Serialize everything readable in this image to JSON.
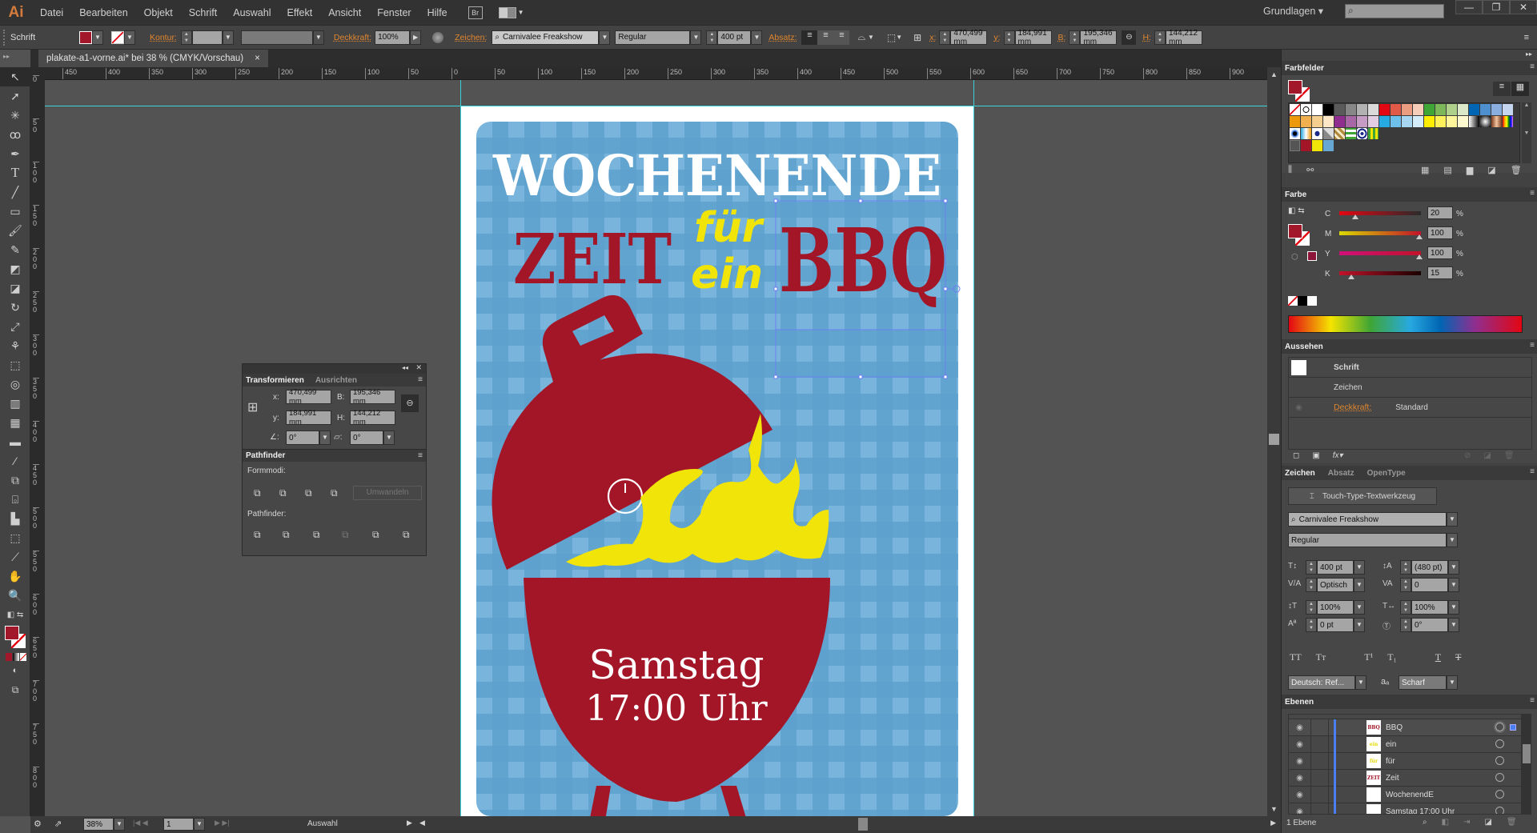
{
  "app": {
    "logo": "Ai",
    "menu": [
      "Datei",
      "Bearbeiten",
      "Objekt",
      "Schrift",
      "Auswahl",
      "Effekt",
      "Ansicht",
      "Fenster",
      "Hilfe"
    ],
    "bridge": "Br",
    "workspace": "Grundlagen ▾",
    "window_controls": [
      "—",
      "❐",
      "✕"
    ]
  },
  "control": {
    "label": "Schrift",
    "kontur": "Kontur:",
    "deckkraft": "Deckkraft:",
    "opacity": "100%",
    "zeichen": "Zeichen:",
    "font": "Carnivalee Freakshow",
    "style": "Regular",
    "size": "400 pt",
    "absatz": "Absatz:",
    "x_label": "x:",
    "x": "470,499 mm",
    "y_label": "y:",
    "y": "184,991 mm",
    "b_label": "B:",
    "b": "195,346 mm",
    "h_label": "H:",
    "h": "144,212 mm"
  },
  "document": {
    "tab": "plakate-a1-vorne.ai* bei 38 % (CMYK/Vorschau)",
    "close": "×"
  },
  "rulers": {
    "h": [
      "450",
      "400",
      "350",
      "300",
      "250",
      "200",
      "150",
      "100",
      "50",
      "0",
      "50",
      "100",
      "150",
      "200",
      "250",
      "300",
      "350",
      "400",
      "450",
      "500",
      "550",
      "600",
      "650",
      "700",
      "750",
      "800",
      "850",
      "900"
    ],
    "v": [
      "0",
      "50",
      "100",
      "150",
      "200",
      "250",
      "300",
      "350",
      "400",
      "450",
      "500",
      "550",
      "600",
      "650",
      "700",
      "750",
      "800"
    ]
  },
  "poster": {
    "line1": "WOCHENENDE",
    "zeit": "ZEIT",
    "fuer": "für",
    "ein": "ein",
    "bbq": "BBQ",
    "day": "Samstag",
    "time": "17:00 Uhr",
    "colors": {
      "blue": "#67a7d4",
      "red": "#a31628",
      "yellow": "#f0e409",
      "white": "#ffffff"
    }
  },
  "transform": {
    "tab1": "Transformieren",
    "tab2": "Ausrichten",
    "x_label": "x:",
    "x": "470,499 mm",
    "y_label": "y:",
    "y": "184,991 mm",
    "b_label": "B:",
    "b": "195,346 mm",
    "h_label": "H:",
    "h": "144,212 mm",
    "rot": "0°",
    "shear": "0°"
  },
  "pathfinder": {
    "title": "Pathfinder",
    "formmodi": "Formmodi:",
    "umwandeln": "Umwandeln",
    "pathfinder_label": "Pathfinder:"
  },
  "farbfelder": {
    "title": "Farbfelder",
    "row1": [
      "none",
      "reg",
      "#ffffff",
      "#000000",
      "#5a5a5a",
      "#878787",
      "#b2b2b2",
      "#dadada",
      "#e30613",
      "#e05a47",
      "#eb9d81",
      "#f6cdb8",
      "#3fa535",
      "#7cb85a",
      "#afd08b",
      "#dbe9c8",
      "#0065b3",
      "#4e8fd0",
      "#8aafde",
      "#c6d5ee"
    ],
    "row2": [
      "#ec9a0c",
      "#f0b050",
      "#f5cf8f",
      "#fbe6c6",
      "#902e8f",
      "#a867a7",
      "#c69cc4",
      "#e3cde2",
      "#27a9e1",
      "#6dc0ea",
      "#a6d6f2",
      "#d4ebf9",
      "#ffed00",
      "#fff159",
      "#fff59b",
      "#fffad0",
      "grad-bw",
      "grad-radial",
      "grad-copper",
      "grad-rainbow"
    ],
    "row3": [
      "pat1",
      "pat2",
      "pat3",
      "pat4",
      "pat5",
      "pat6",
      "pat7",
      "pat8"
    ],
    "row4": [
      "folder",
      "#a31628",
      "#f0e409",
      "#67a7d4"
    ]
  },
  "farbe": {
    "title": "Farbe",
    "channels": [
      {
        "label": "C",
        "value": "20",
        "pct": 20
      },
      {
        "label": "M",
        "value": "100",
        "pct": 100
      },
      {
        "label": "Y",
        "value": "100",
        "pct": 100
      },
      {
        "label": "K",
        "value": "15",
        "pct": 15
      }
    ],
    "unit": "%"
  },
  "aussehen": {
    "title": "Aussehen",
    "rows": [
      "Schrift",
      "Zeichen"
    ],
    "deckkraft": "Deckkraft:",
    "standard": "Standard"
  },
  "zeichen": {
    "tab1": "Zeichen",
    "tab2": "Absatz",
    "tab3": "OpenType",
    "touch": "Touch-Type-Textwerkzeug",
    "font": "Carnivalee Freakshow",
    "style": "Regular",
    "size": "400 pt",
    "leading": "(480 pt)",
    "kerning": "Optisch",
    "tracking": "0",
    "vscale": "100%",
    "hscale": "100%",
    "baseline": "0 pt",
    "rotation": "0°",
    "lang": "Deutsch: Ref...",
    "aa": "Scharf"
  },
  "ebenen": {
    "title": "Ebenen",
    "layers": [
      {
        "name": "BBQ",
        "thumb": "BBQ",
        "color": "#a31628"
      },
      {
        "name": "ein",
        "thumb": "ein",
        "color": "#e5d800"
      },
      {
        "name": "für",
        "thumb": "für",
        "color": "#e5d800"
      },
      {
        "name": "Zeit",
        "thumb": "ZEIT",
        "color": "#a31628"
      },
      {
        "name": "WochenendE",
        "thumb": "",
        "color": "#fff"
      },
      {
        "name": "Samstag 17:00 Uhr",
        "thumb": "",
        "color": "#fff"
      }
    ],
    "footer": "1 Ebene"
  },
  "status": {
    "zoom": "38%",
    "page": "1",
    "tool": "Auswahl"
  }
}
